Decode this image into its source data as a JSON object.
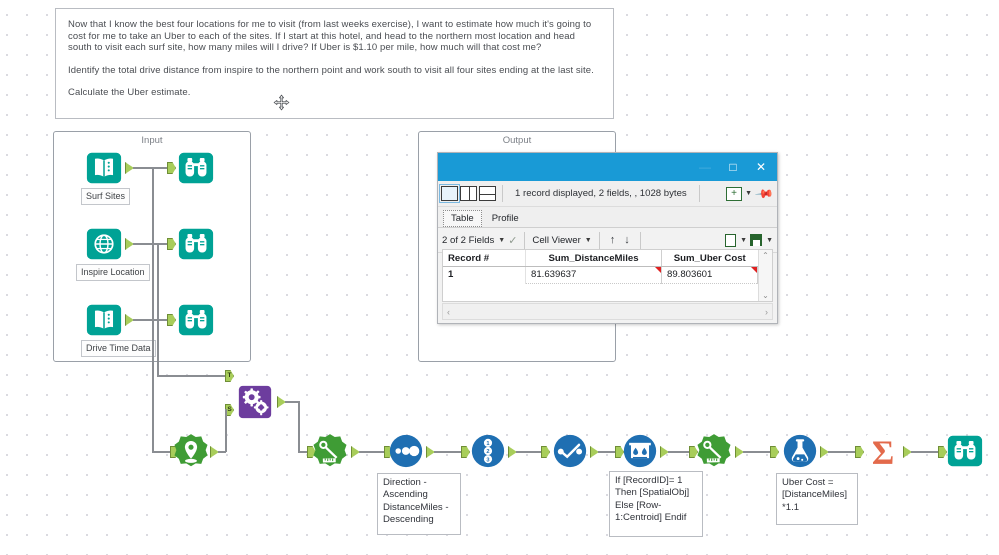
{
  "app": {
    "canvas_name": "alteryx-workflow-canvas"
  },
  "comment": {
    "name": "comment-box",
    "paragraphs": [
      "Now that I know the best four locations for me to visit (from last weeks exercise), I want to estimate how much it's going to cost for me to take an Uber to each of the sites. If I start at this hotel, and head to the northern most location and head south to visit each surf site, how many miles will I drive? If Uber is $1.10 per mile, how much will that cost me?",
      "Identify the total drive distance from inspire to the northern point and work south to visit all four sites ending at the last site.",
      "Calculate the Uber estimate."
    ]
  },
  "containers": {
    "input": {
      "title": "Input"
    },
    "output": {
      "title": "Output"
    }
  },
  "input_tools": [
    {
      "label": "Surf Sites",
      "icon": "input-data-icon",
      "browse_icon": "browse-icon"
    },
    {
      "label": "Inspire Location",
      "icon": "globe-input-icon",
      "browse_icon": "browse-icon"
    },
    {
      "label": "Drive Time Data",
      "icon": "input-data-icon",
      "browse_icon": "browse-icon"
    }
  ],
  "workflow_tools": [
    {
      "name": "spatial-match-tool",
      "icon": "gears-icon",
      "in_labels": [
        "T",
        "S"
      ]
    },
    {
      "name": "find-nearest-tool",
      "icon": "map-pin-icon"
    },
    {
      "name": "distance-tool",
      "icon": "ruler-icon"
    },
    {
      "name": "sort-tool",
      "icon": "three-dots-icon"
    },
    {
      "name": "record-id-tool",
      "icon": "numbered-list-icon"
    },
    {
      "name": "multi-row-formula-tool",
      "icon": "checkmark-line-icon"
    },
    {
      "name": "spatial-process-tool",
      "icon": "bucket-drop-icon"
    },
    {
      "name": "distance-tool-2",
      "icon": "ruler-icon"
    },
    {
      "name": "formula-tool",
      "icon": "flask-icon"
    },
    {
      "name": "summarize-tool",
      "icon": "sigma-icon"
    },
    {
      "name": "browse-tool-final",
      "icon": "browse-icon"
    }
  ],
  "annotations": [
    {
      "name": "sort-annotation",
      "text": "Direction - Ascending DistanceMiles - Descending"
    },
    {
      "name": "formula-annotation",
      "text": "If [RecordID]= 1 Then [SpatialObj] Else [Row-1:Centroid]  Endif"
    },
    {
      "name": "uber-annotation",
      "text": "Uber Cost = [DistanceMiles] *1.1"
    }
  ],
  "results_window": {
    "title_buttons": {
      "minimize": "—",
      "maximize": "□",
      "close": "✕"
    },
    "status": "1 record displayed, 2 fields, , 1028 bytes",
    "layout_buttons": [
      "single-pane-icon",
      "two-column-icon",
      "two-row-icon"
    ],
    "add_button": "+",
    "pin_button": "pin-icon",
    "tabs": [
      {
        "label": "Table",
        "active": true
      },
      {
        "label": "Profile",
        "active": false
      }
    ],
    "fields_selector": "2 of 2 Fields",
    "cell_viewer": "Cell Viewer",
    "sort_up": "↑",
    "sort_down": "↓",
    "copy_icon": "copy-icon",
    "save_icon": "save-icon",
    "table": {
      "columns": [
        "Record #",
        "Sum_DistanceMiles",
        "Sum_Uber Cost"
      ],
      "rows": [
        {
          "record": "1",
          "distance": "81.639637",
          "uber": "89.803601"
        }
      ]
    },
    "hscroll": {
      "left": "‹",
      "right": "›"
    },
    "vscroll": {
      "up": "⌃",
      "down": "⌄"
    }
  },
  "colors": {
    "teal": "#00a295",
    "green": "#3f9c35",
    "blue": "#1f6fb2",
    "purple": "#6d3d9e",
    "orange": "#e36a4b",
    "titlebar_blue": "#199ad6",
    "anchor_green": "#a8cd5a",
    "wire_gray": "#8a8d92"
  },
  "cursor": {
    "name": "move-cursor",
    "glyph": "✥"
  }
}
